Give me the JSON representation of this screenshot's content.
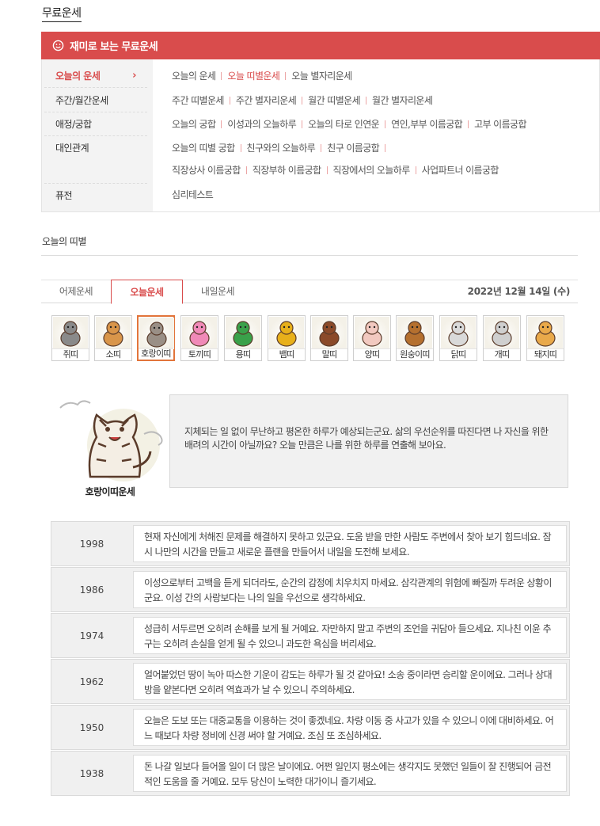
{
  "page_title": "무료운세",
  "banner": {
    "title": "재미로 보는 무료운세",
    "icon": "smile-icon"
  },
  "menu": {
    "categories": [
      {
        "label": "오늘의 운세",
        "active": true,
        "chevron": "›"
      },
      {
        "label": "주간/월간운세"
      },
      {
        "label": "애정/궁합"
      },
      {
        "label": "대인관계"
      },
      {
        "label": "퓨전"
      }
    ],
    "rows": [
      [
        "오늘의 운세",
        "오늘 띠별운세",
        "오늘 별자리운세"
      ],
      [
        "주간 띠별운세",
        "주간 별자리운세",
        "월간 띠별운세",
        "월간 별자리운세"
      ],
      [
        "오늘의 궁합",
        "이성과의 오늘하루",
        "오늘의 타로 인연운",
        "연인,부부 이름궁합",
        "고부 이름궁합"
      ],
      [
        "오늘의 띠별 궁합",
        "친구와의 오늘하루",
        "친구 이름궁합"
      ],
      [
        "직장상사 이름궁합",
        "직장부하 이름궁합",
        "직장에서의 오늘하루",
        "사업파트너 이름궁합"
      ],
      [
        "심리테스트"
      ]
    ]
  },
  "section_label": "오늘의 띠별",
  "tabs": [
    "어제운세",
    "오늘운세",
    "내일운세"
  ],
  "date": "2022년 12월 14일 (수)",
  "zodiac": [
    "쥐띠",
    "소띠",
    "호랑이띠",
    "토끼띠",
    "용띠",
    "뱀띠",
    "말띠",
    "양띠",
    "원숭이띠",
    "닭띠",
    "개띠",
    "돼지띠"
  ],
  "selected_zodiac": "호랑이띠",
  "zodiac_colors": [
    "#8a8a8a",
    "#d9954a",
    "#9a8f86",
    "#f08ab8",
    "#3aa14a",
    "#e8b01a",
    "#8b4a2a",
    "#f2c9c0",
    "#b5702f",
    "#d9d9d9",
    "#cfcfcf",
    "#e9a94a"
  ],
  "featured": {
    "caption": "호랑이띠운세",
    "summary": "지체되는 일 없이 무난하고 평온한 하루가 예상되는군요. 삶의 우선순위를 따진다면 나 자신을 위한 배려의 시간이 아닐까요? 오늘 만큼은 나를 위한 하루를 연출해 보아요."
  },
  "years": [
    {
      "year": "1998",
      "text": "현재 자신에게 처해진 문제를 해결하지 못하고 있군요. 도움 받을 만한 사람도 주변에서 찾아 보기 힘드네요. 잠시 나만의 시간을 만들고 새로운 플랜을 만들어서 내일을 도전해 보세요."
    },
    {
      "year": "1986",
      "text": "이성으로부터 고백을 듣게 되더라도, 순간의 감정에 치우치지 마세요. 삼각관계의 위험에 빠질까 두려운 상황이군요. 이성 간의 사랑보다는 나의 일을 우선으로 생각하세요."
    },
    {
      "year": "1974",
      "text": "성급히 서두르면 오히려 손해를 보게 될 거예요. 자만하지 말고 주변의 조언을 귀담아 들으세요. 지나친 이윤 추구는 오히려 손실을 얻게 될 수 있으니 과도한 욕심을 버리세요."
    },
    {
      "year": "1962",
      "text": "얼어붙었던 땅이 녹아 따스한 기운이 감도는 하루가 될 것 같아요! 소송 중이라면 승리할 운이에요. 그러나 상대방을 얕본다면 오히려 역효과가 날 수 있으니 주의하세요."
    },
    {
      "year": "1950",
      "text": "오늘은 도보 또는 대중교통을 이용하는 것이 좋겠네요. 차량 이동 중 사고가 있을 수 있으니 이에 대비하세요. 어느 때보다 차량 정비에 신경 써야 할 거예요. 조심 또 조심하세요."
    },
    {
      "year": "1938",
      "text": "돈 나갈 일보다 들어올 일이 더 많은 날이에요. 어쩐 일인지 평소에는 생각지도 못했던 일들이 잘 진행되어 금전적인 도움을 줄 거예요. 모두 당신이 노력한 대가이니 즐기세요."
    }
  ]
}
